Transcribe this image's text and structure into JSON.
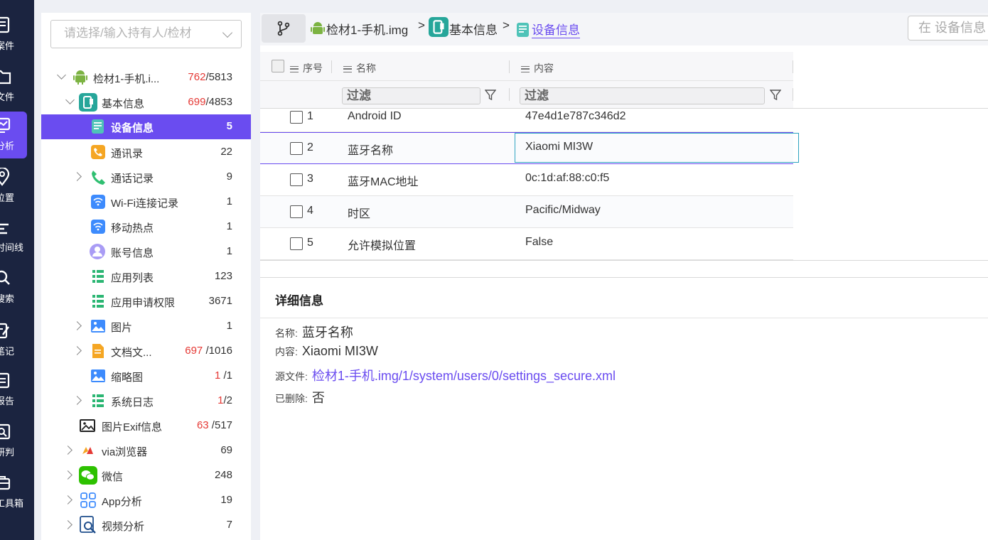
{
  "nav": {
    "items": [
      {
        "label": "案件",
        "icon": "case-icon"
      },
      {
        "label": "文件",
        "icon": "folder-icon"
      },
      {
        "label": "分析",
        "icon": "analysis-icon"
      },
      {
        "label": "位置",
        "icon": "location-icon"
      },
      {
        "label": "时间线",
        "icon": "timeline-icon"
      },
      {
        "label": "搜索",
        "icon": "search-icon"
      },
      {
        "label": "笔记",
        "icon": "note-icon"
      },
      {
        "label": "报告",
        "icon": "report-icon"
      },
      {
        "label": "研判",
        "icon": "judge-icon"
      },
      {
        "label": "工具箱",
        "icon": "toolbox-icon"
      }
    ],
    "active_index": 2,
    "accent": "#6a4cf0"
  },
  "tree": {
    "holder_placeholder": "请选择/输入持有人/检材",
    "items": [
      {
        "label": "检材1-手机.i...",
        "count_red": "762",
        "count_rest": "/5813",
        "icon": "android-icon"
      },
      {
        "label": "基本信息",
        "count_red": "699",
        "count_rest": "/4853",
        "icon": "basic-info-icon"
      },
      {
        "label": "设备信息",
        "count_red": "",
        "count_rest": "5",
        "icon": "device-info-icon"
      },
      {
        "label": "通讯录",
        "count_red": "",
        "count_rest": "22",
        "icon": "contacts-icon"
      },
      {
        "label": "通话记录",
        "count_red": "",
        "count_rest": "9",
        "icon": "phone-icon"
      },
      {
        "label": "Wi-Fi连接记录",
        "count_red": "",
        "count_rest": "1",
        "icon": "wifi-icon"
      },
      {
        "label": "移动热点",
        "count_red": "",
        "count_rest": "1",
        "icon": "hotspot-icon"
      },
      {
        "label": "账号信息",
        "count_red": "",
        "count_rest": "1",
        "icon": "account-icon"
      },
      {
        "label": "应用列表",
        "count_red": "",
        "count_rest": "123",
        "icon": "app-list-icon"
      },
      {
        "label": "应用申请权限",
        "count_red": "",
        "count_rest": "3671",
        "icon": "permission-icon"
      },
      {
        "label": "图片",
        "count_red": "",
        "count_rest": "1",
        "icon": "image-icon"
      },
      {
        "label": "文档文...",
        "count_red": "697",
        "count_rest": " /1016",
        "icon": "document-icon"
      },
      {
        "label": "缩略图",
        "count_red": "1",
        "count_rest": " /1",
        "icon": "thumbnail-icon"
      },
      {
        "label": "系统日志",
        "count_red": "1",
        "count_rest": "/2",
        "icon": "syslog-icon"
      },
      {
        "label": "图片Exif信息",
        "count_red": "63",
        "count_rest": " /517",
        "icon": "exif-icon"
      },
      {
        "label": "via浏览器",
        "count_red": "",
        "count_rest": "69",
        "icon": "via-browser-icon"
      },
      {
        "label": "微信",
        "count_red": "",
        "count_rest": "248",
        "icon": "wechat-icon"
      },
      {
        "label": "App分析",
        "count_red": "",
        "count_rest": "19",
        "icon": "app-analysis-icon"
      },
      {
        "label": "视频分析",
        "count_red": "",
        "count_rest": "7",
        "icon": "video-analysis-icon"
      }
    ]
  },
  "breadcrumb": {
    "items": [
      "检材1-手机.img",
      "基本信息",
      "设备信息"
    ],
    "separator": ">"
  },
  "search": {
    "placeholder": "在 设备信息"
  },
  "table": {
    "columns": {
      "index": "序号",
      "name": "名称",
      "content": "内容"
    },
    "filter_placeholder": "过滤",
    "rows": [
      {
        "index": "1",
        "name": "Android ID",
        "content": "47e4d1e787c346d2"
      },
      {
        "index": "2",
        "name": "蓝牙名称",
        "content": "Xiaomi MI3W"
      },
      {
        "index": "3",
        "name": "蓝牙MAC地址",
        "content": "0c:1d:af:88:c0:f5"
      },
      {
        "index": "4",
        "name": "时区",
        "content": "Pacific/Midway"
      },
      {
        "index": "5",
        "name": "允许模拟位置",
        "content": "False"
      }
    ],
    "selected_index": 2
  },
  "detail": {
    "title": "详细信息",
    "name_label": "名称:",
    "name_value": "蓝牙名称",
    "content_label": "内容:",
    "content_value": "Xiaomi MI3W",
    "source_label": "源文件:",
    "source_value": "检材1-手机.img/1/system/users/0/settings_secure.xml",
    "deleted_label": "已删除:",
    "deleted_value": "否"
  }
}
